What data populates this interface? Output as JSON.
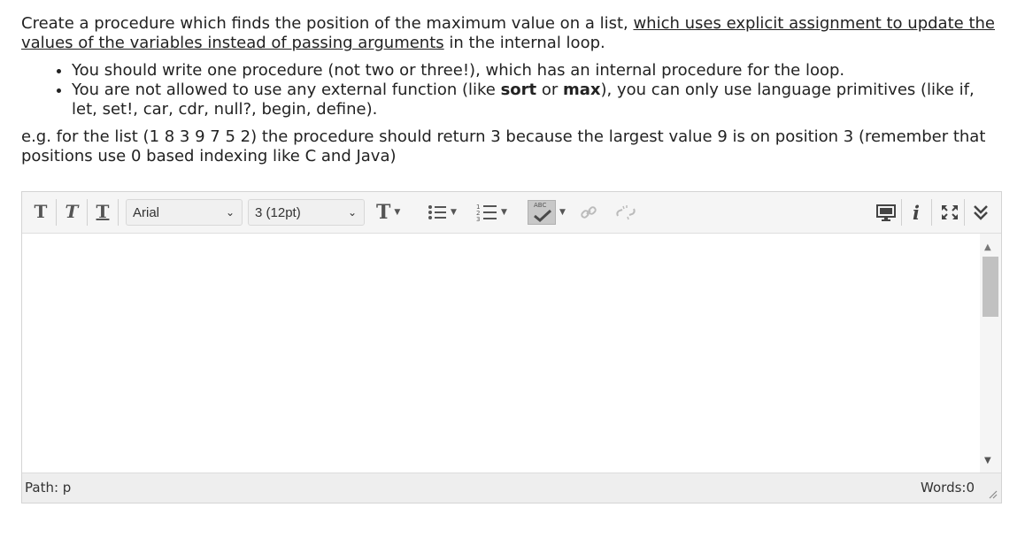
{
  "question": {
    "intro_plain": "Create a procedure which finds the position of the maximum value on a list, ",
    "intro_underlined": "which uses explicit assignment to update the values of the variables instead of passing arguments",
    "intro_end": " in the internal loop.",
    "bullet1": "You should write one procedure (not two or three!), which has an internal procedure for the loop.",
    "bullet2_a": "You are not allowed to use any external function (like ",
    "bullet2_sort": "sort",
    "bullet2_or": " or ",
    "bullet2_max": "max",
    "bullet2_b": "), you can only use language primitives (like if, let, set!, car, cdr, null?, begin, define).",
    "example": "e.g. for the list (1 8 3 9 7 5 2) the procedure should return 3 because the largest value 9 is on position 3 (remember that positions use 0 based indexing like C and Java)"
  },
  "toolbar": {
    "bold_glyph": "T",
    "italic_glyph": "T",
    "underline_glyph": "T",
    "font_family": "Arial",
    "font_size": "3 (12pt)",
    "text_color_glyph": "T",
    "spellcheck_label": "ABC"
  },
  "statusbar": {
    "path": "Path: p",
    "words": "Words:0"
  }
}
